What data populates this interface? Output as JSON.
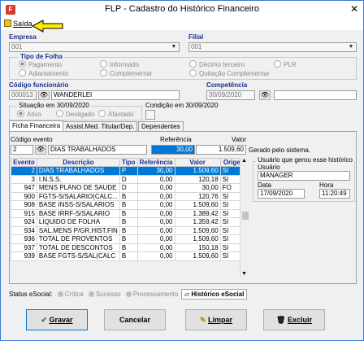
{
  "window": {
    "title": "FLP - Cadastro do Histórico Financeiro",
    "close_glyph": "✕"
  },
  "menu": {
    "exit": "Saída"
  },
  "empresa": {
    "label": "Empresa",
    "value": "001"
  },
  "filial": {
    "label": "Filial",
    "value": "001"
  },
  "tipo_folha": {
    "label": "Tipo de Folha",
    "options": [
      "Pagamento",
      "Informado",
      "Décimo terceiro",
      "PLR",
      "Adiantamento",
      "Complementar",
      "Quitação Complementar"
    ],
    "selected": "Pagamento"
  },
  "funcionario": {
    "label": "Código funcionário",
    "code": "000013",
    "name": "WANDERLEI"
  },
  "competencia": {
    "label": "Competência",
    "value": "30/09/2020"
  },
  "situacao": {
    "label": "Situação em 30/09/2020",
    "options": [
      "Ativo",
      "Desligado",
      "Afastado"
    ],
    "selected": "Ativo"
  },
  "condicao": {
    "label": "Condição em 30/09/2020"
  },
  "tabs": [
    "Ficha Financeira",
    "Assist.Med. Titular/Dep.",
    "Dependentes"
  ],
  "evento": {
    "label": "Código evento",
    "code": "2",
    "description": "DIAS TRABALHADOS",
    "referencia_label": "Referência",
    "referencia": "30,00",
    "valor_label": "Valor",
    "valor": "1.509,60",
    "note": "Gerado pelo sistema."
  },
  "table": {
    "headers": [
      "Evento",
      "Descrição",
      "Tipo",
      "Referência",
      "Valor",
      "Origem"
    ],
    "rows": [
      [
        "2",
        "DIAS TRABALHADOS",
        "P",
        "30,00",
        "1.509,60",
        "SI"
      ],
      [
        "3",
        "I.N.S.S.",
        "D",
        "0,00",
        "120,18",
        "SI"
      ],
      [
        "947",
        "MENS PLANO DE SAUDE",
        "D",
        "0,00",
        "30,00",
        "FO"
      ],
      [
        "900",
        "FGTS-S/SALARIO(CALC...",
        "B",
        "0,00",
        "120,76",
        "SI"
      ],
      [
        "908",
        "BASE INSS-S/SALARIOS",
        "B",
        "0,00",
        "1.509,60",
        "SI"
      ],
      [
        "915",
        "BASE IRRF-S/SALARIO",
        "B",
        "0,00",
        "1.389,42",
        "SI"
      ],
      [
        "924",
        "LIQUIDO DE FOLHA",
        "B",
        "0,00",
        "1.359,42",
        "SI"
      ],
      [
        "934",
        "SAL.MENS P/GR.HIST.FIN",
        "B",
        "0,00",
        "1.509,60",
        "SI"
      ],
      [
        "936",
        "TOTAL DE PROVENTOS",
        "B",
        "0,00",
        "1.509,60",
        "SI"
      ],
      [
        "937",
        "TOTAL DE DESCONTOS",
        "B",
        "0,00",
        "150,18",
        "SI"
      ],
      [
        "939",
        "BASE FGTS-S/SAL(CALC",
        "B",
        "0,00",
        "1.509,60",
        "SI"
      ]
    ]
  },
  "historico": {
    "title": "Usuário que gerou esse histórico",
    "usuario_label": "Usuário",
    "usuario": "MANAGER",
    "data_label": "Data",
    "data": "17/09/2020",
    "hora_label": "Hora",
    "hora": "11:20:49"
  },
  "esocial": {
    "label": "Status eSocial:",
    "statuses": [
      "Crítica",
      "Sucesso",
      "Processamento"
    ],
    "button": "Histórico eSocial"
  },
  "buttons": {
    "save": "Gravar",
    "cancel": "Cancelar",
    "clear": "Limpar",
    "delete": "Excluir"
  },
  "colors": {
    "accent": "#0078d7",
    "label_blue": "#1b2f8c",
    "arrow_fill": "#ffeb00"
  }
}
